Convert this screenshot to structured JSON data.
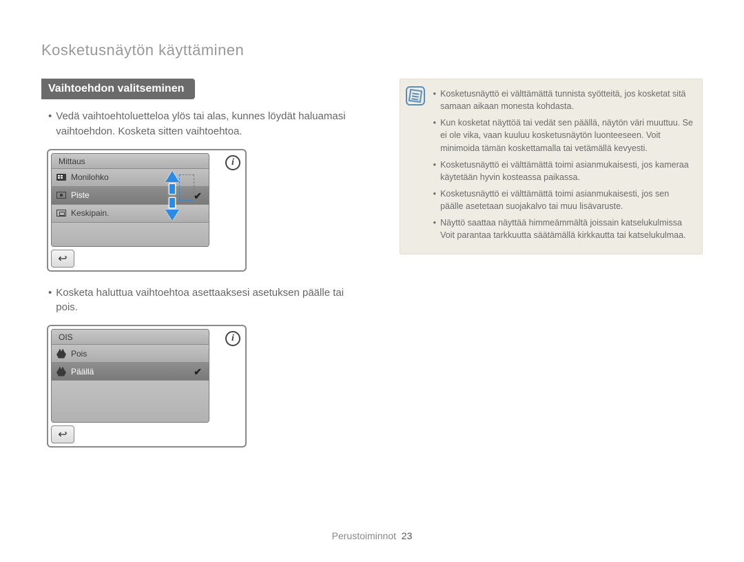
{
  "page_title": "Kosketusnäytön käyttäminen",
  "section_header": "Vaihtoehdon valitseminen",
  "intro_bullet": "Vedä vaihtoehtoluetteloa ylös tai alas, kunnes löydät haluamasi vaihtoehdon. Kosketa sitten vaihtoehtoa.",
  "screenshot1": {
    "title": "Mittaus",
    "items": {
      "0": {
        "label": "Monilohko"
      },
      "1": {
        "label": "Piste"
      },
      "2": {
        "label": "Keskipain."
      }
    }
  },
  "mid_bullet": "Kosketa haluttua vaihtoehtoa asettaaksesi asetuksen päälle tai pois.",
  "screenshot2": {
    "title": "OIS",
    "items": {
      "0": {
        "label": "Pois"
      },
      "1": {
        "label": "Päällä"
      }
    }
  },
  "notes": {
    "0": "Kosketusnäyttö ei välttämättä tunnista syötteitä, jos kosketat sitä samaan aikaan monesta kohdasta.",
    "1": "Kun kosketat näyttöä tai vedät sen päällä, näytön väri muuttuu. Se ei ole vika, vaan kuuluu kosketusnäytön luonteeseen. Voit minimoida tämän koskettamalla tai vetämällä kevyesti.",
    "2": "Kosketusnäyttö ei välttämättä toimi asianmukaisesti, jos kameraa käytetään hyvin kosteassa paikassa.",
    "3": "Kosketusnäyttö ei välttämättä toimi asianmukaisesti, jos sen päälle asetetaan suojakalvo tai muu lisävaruste.",
    "4": "Näyttö saattaa näyttää himmeämmältä joissain katselukulmissa Voit parantaa tarkkuutta säätämällä kirkkautta tai katselukulmaa."
  },
  "footer_label": "Perustoiminnot",
  "footer_page": "23"
}
